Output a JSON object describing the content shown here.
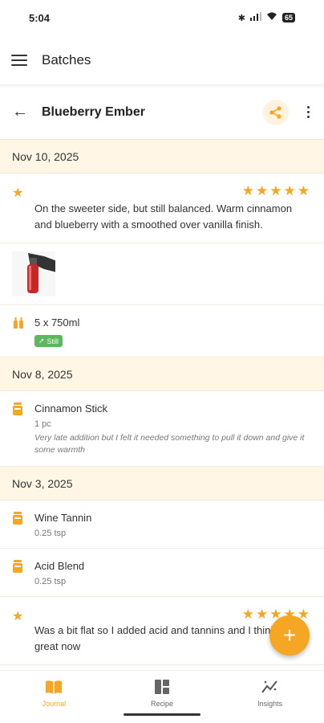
{
  "status": {
    "time": "5:04",
    "battery": "65"
  },
  "appbar": {
    "title": "Batches"
  },
  "detail": {
    "title": "Blueberry Ember"
  },
  "groups": [
    {
      "date": "Nov 10, 2025",
      "rating_text": "On the sweeter side, but still balanced. Warm cinnamon and blueberry with a smoothed over vanilla finish.",
      "bottling": {
        "label": "5 x 750ml",
        "tag": "Still"
      }
    },
    {
      "date": "Nov 8, 2025",
      "addition": {
        "name": "Cinnamon Stick",
        "amount": "1 pc",
        "note": "Very late addition but I felt it needed something to pull it down and give it some warmth"
      }
    },
    {
      "date": "Nov 3, 2025",
      "additions": [
        {
          "name": "Wine Tannin",
          "amount": "0.25 tsp"
        },
        {
          "name": "Acid Blend",
          "amount": "0.25 tsp"
        }
      ],
      "rating_text": "Was a bit flat so I added acid and tannins and I think it's great now"
    }
  ],
  "fab": {
    "label": "+"
  },
  "nav": [
    {
      "label": "Journal"
    },
    {
      "label": "Recipe"
    },
    {
      "label": "Insights"
    }
  ],
  "colors": {
    "accent": "#f5a623",
    "date_bg": "#fff6e6",
    "tag_green": "#5cb85c"
  }
}
